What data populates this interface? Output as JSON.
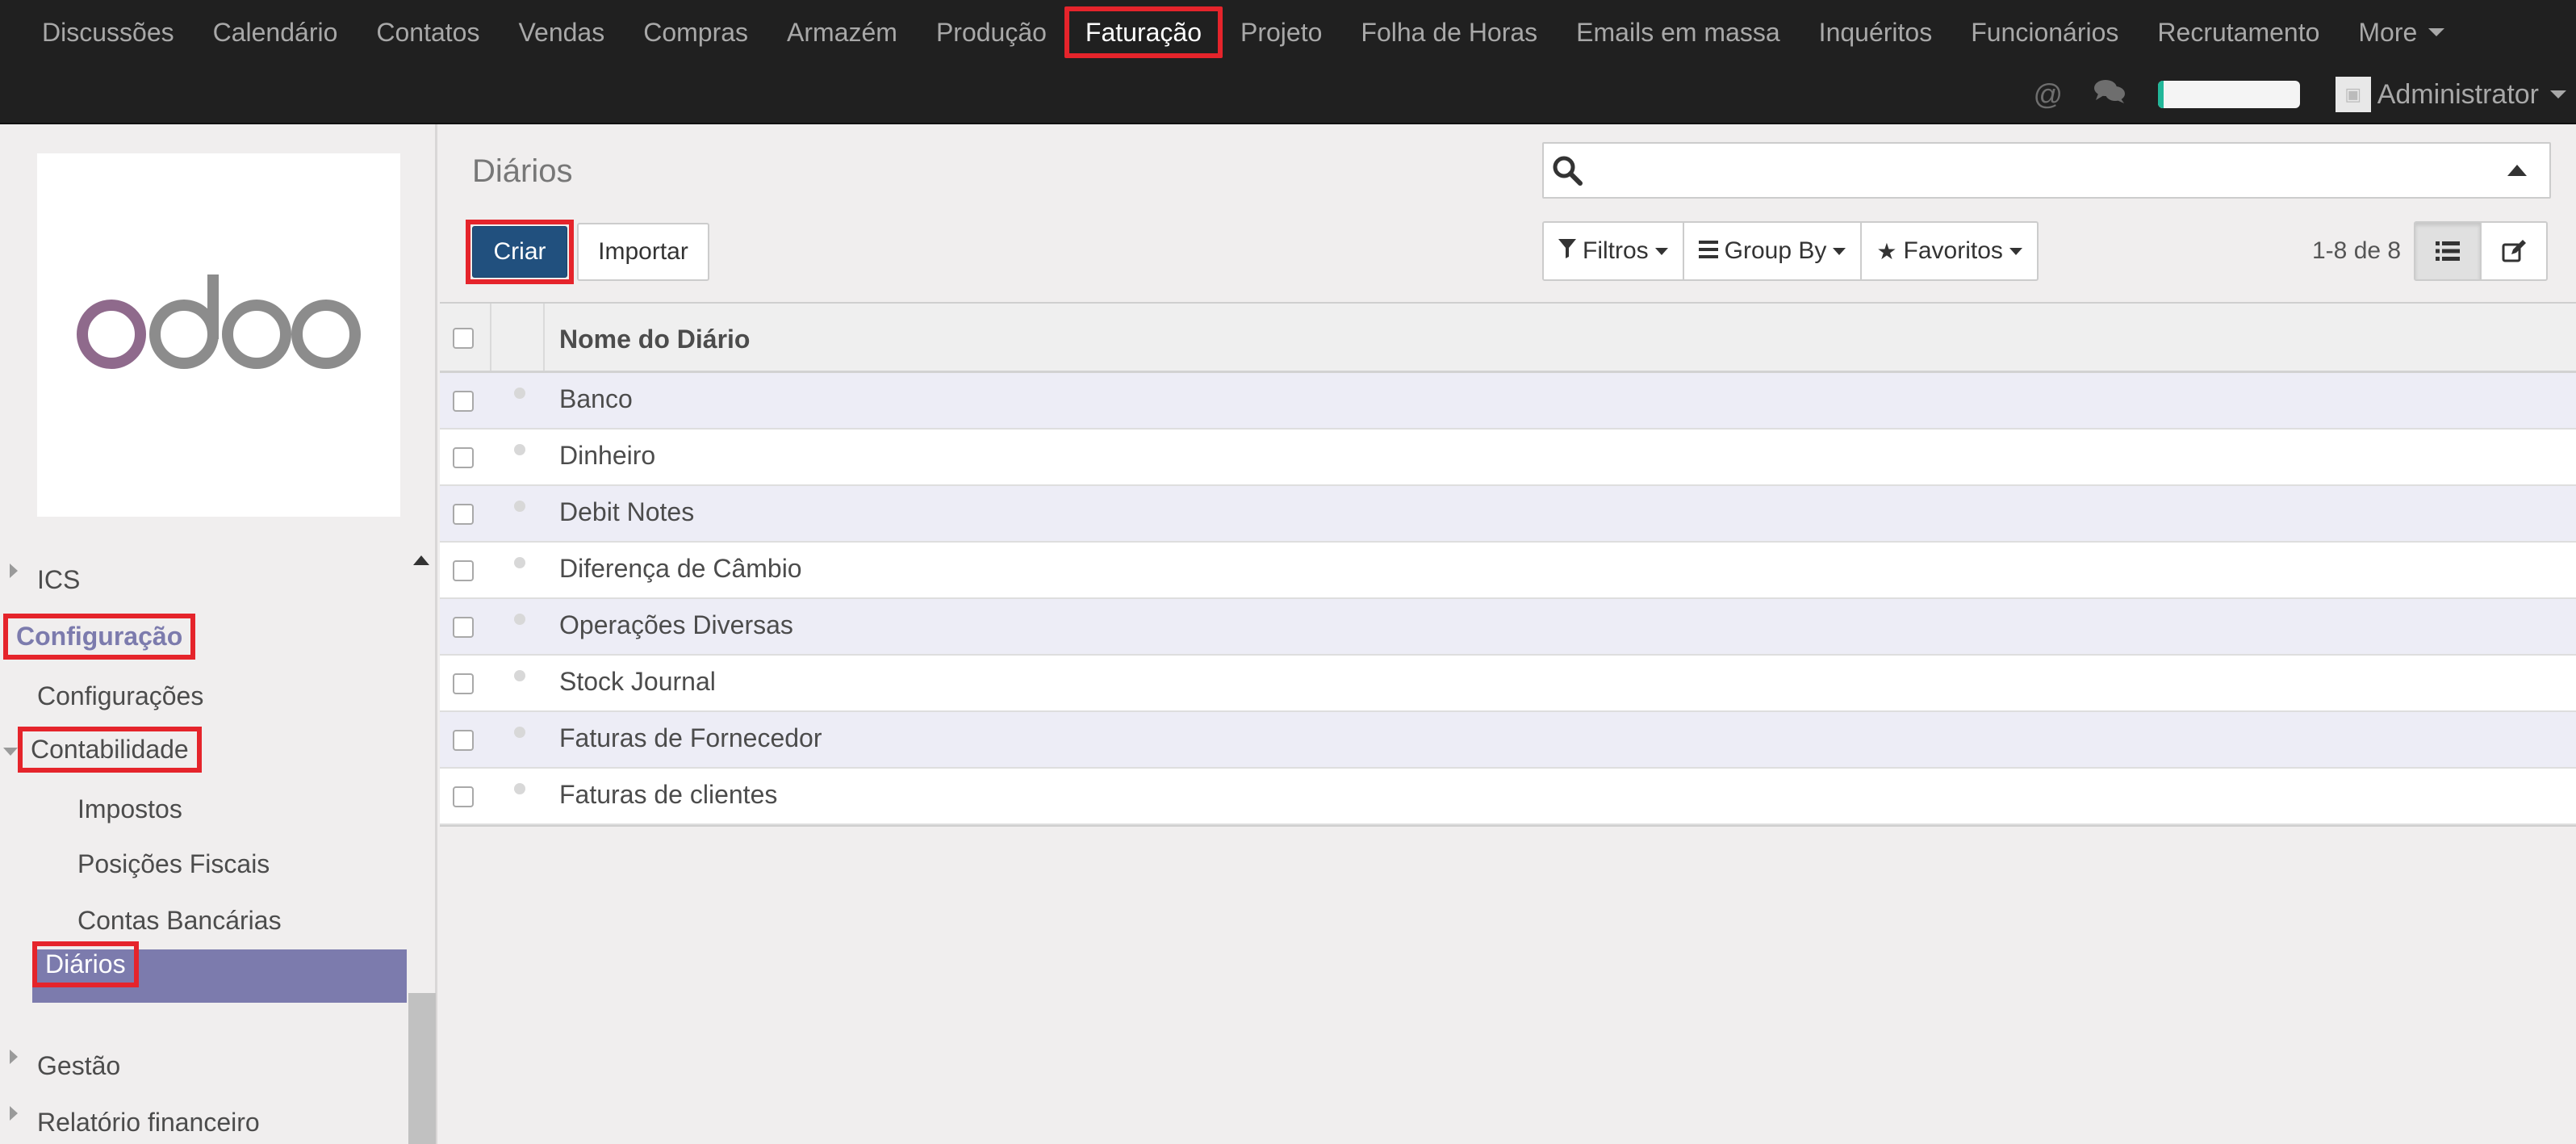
{
  "nav": {
    "items": [
      {
        "label": "Discussões"
      },
      {
        "label": "Calendário"
      },
      {
        "label": "Contatos"
      },
      {
        "label": "Vendas"
      },
      {
        "label": "Compras"
      },
      {
        "label": "Armazém"
      },
      {
        "label": "Produção"
      },
      {
        "label": "Faturação"
      },
      {
        "label": "Projeto"
      },
      {
        "label": "Folha de Horas"
      },
      {
        "label": "Emails em massa"
      },
      {
        "label": "Inquéritos"
      },
      {
        "label": "Funcionários"
      },
      {
        "label": "Recrutamento"
      },
      {
        "label": "More"
      }
    ],
    "active": "Faturação",
    "user": "Administrator",
    "progress": 0.04,
    "icons": [
      "at-icon",
      "chat-bubbles-icon"
    ]
  },
  "sidebar": {
    "logo_text": "odoo",
    "items": {
      "ics": "ICS",
      "configuracao": "Configuração",
      "configuracoes": "Configurações",
      "contabilidade": "Contabilidade",
      "impostos": "Impostos",
      "posicoes": "Posições Fiscais",
      "contas": "Contas Bancárias",
      "diarios": "Diários",
      "gestao": "Gestão",
      "relatorio": "Relatório financeiro"
    },
    "accent": "#7c7bad"
  },
  "main": {
    "title": "Diários",
    "search_placeholder": "",
    "create_label": "Criar",
    "import_label": "Importar",
    "filters_label": "Filtros",
    "groupby_label": "Group By",
    "favorites_label": "Favoritos",
    "pager": "1-8 de 8",
    "primary_color": "#21507e"
  },
  "table": {
    "header": "Nome do Diário",
    "rows": [
      "Banco",
      "Dinheiro",
      "Debit Notes",
      "Diferença de Câmbio",
      "Operações Diversas",
      "Stock Journal",
      "Faturas de Fornecedor",
      "Faturas de clientes"
    ]
  }
}
